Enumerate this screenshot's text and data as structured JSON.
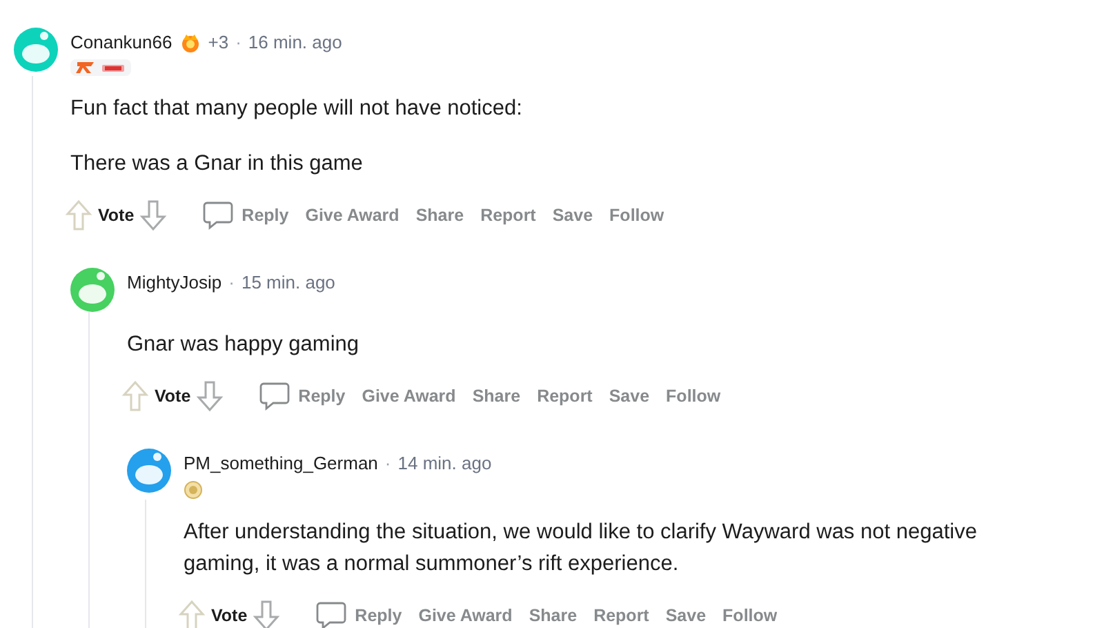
{
  "comments": [
    {
      "author": "Conankun66",
      "color": "#0dd3bb",
      "award": "+3",
      "separator": "·",
      "time": "16 min. ago",
      "flair": {
        "kind": "team"
      },
      "body": [
        "Fun fact that many people will not have noticed:",
        "There was a Gnar in this game"
      ],
      "vote_label": "Vote",
      "actions": [
        "Reply",
        "Give Award",
        "Share",
        "Report",
        "Save",
        "Follow"
      ],
      "children": [
        {
          "author": "MightyJosip",
          "color": "#46d160",
          "separator": "·",
          "time": "15 min. ago",
          "body": [
            "Gnar was happy gaming"
          ],
          "vote_label": "Vote",
          "actions": [
            "Reply",
            "Give Award",
            "Share",
            "Report",
            "Save",
            "Follow"
          ],
          "children": [
            {
              "author": "PM_something_German",
              "color": "#24a0ed",
              "separator": "·",
              "time": "14 min. ago",
              "flair": {
                "kind": "medal"
              },
              "body": [
                "After understanding the situation, we would like to clarify Wayward was not negative gaming, it was a normal summoner’s rift experience."
              ],
              "vote_label": "Vote",
              "actions": [
                "Reply",
                "Give Award",
                "Share",
                "Report",
                "Save",
                "Follow"
              ]
            }
          ]
        }
      ]
    }
  ]
}
